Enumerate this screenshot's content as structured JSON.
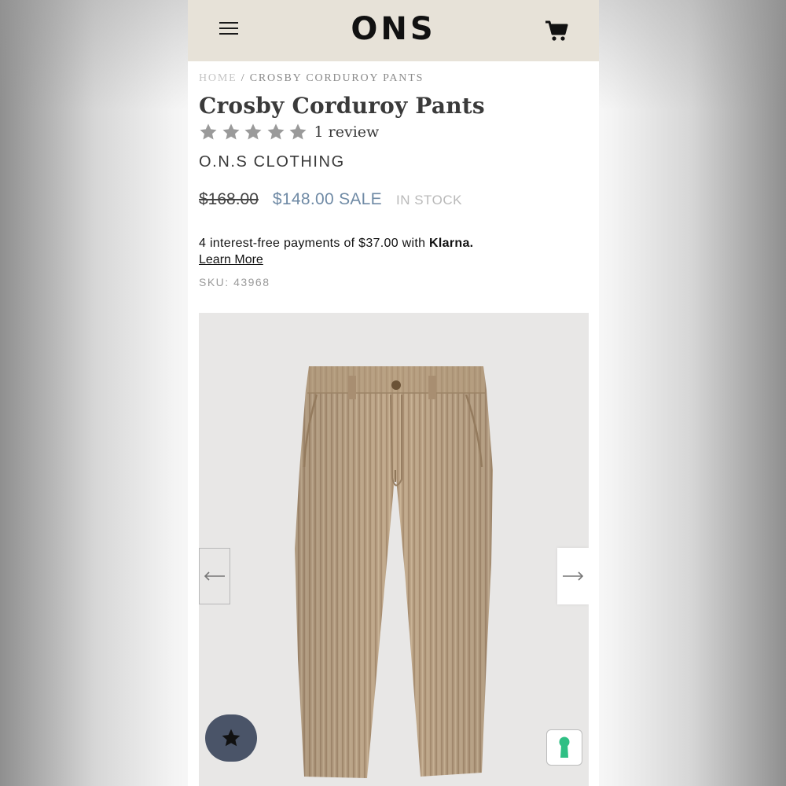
{
  "header": {
    "logo": "ONS",
    "menu_icon": "hamburger-menu-icon",
    "cart_icon": "shopping-cart-icon",
    "background": "#e7e2d8"
  },
  "breadcrumb": {
    "home": "HOME",
    "separator": "/",
    "current": "CROSBY CORDUROY PANTS"
  },
  "product": {
    "title": "Crosby Corduroy Pants",
    "rating": {
      "stars": 5,
      "max": 5,
      "star_color": "#9a9a9a"
    },
    "review_count_label": "1 review",
    "brand": "O.N.S CLOTHING",
    "original_price": "$168.00",
    "sale_price": "$148.00 SALE",
    "sale_color": "#6f8aa5",
    "stock_status": "IN STOCK",
    "klarna_text": "4 interest-free payments of $37.00 with",
    "klarna_brand": "Klarna.",
    "learn_more": "Learn More",
    "sku": "SKU: 43968"
  },
  "gallery": {
    "prev_icon": "arrow-left-icon",
    "next_icon": "arrow-right-icon",
    "image": "tan-corduroy-pants-photo"
  },
  "floating": {
    "reviews_icon": "star-icon",
    "reviews_color": "#4a5468",
    "lock_icon": "keyhole-icon",
    "lock_color": "#2fbf84"
  }
}
